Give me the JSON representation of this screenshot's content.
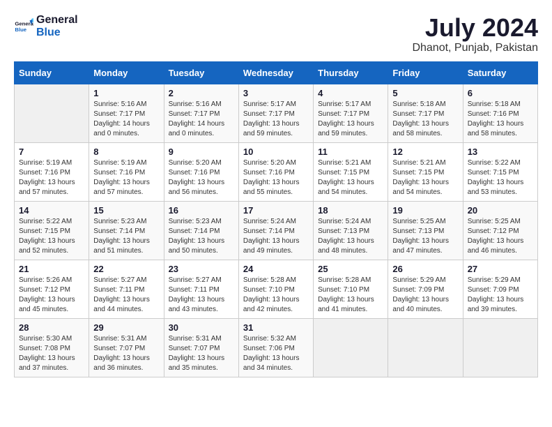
{
  "header": {
    "logo_general": "General",
    "logo_blue": "Blue",
    "month": "July 2024",
    "location": "Dhanot, Punjab, Pakistan"
  },
  "weekdays": [
    "Sunday",
    "Monday",
    "Tuesday",
    "Wednesday",
    "Thursday",
    "Friday",
    "Saturday"
  ],
  "weeks": [
    [
      {
        "day": "",
        "empty": true
      },
      {
        "day": "1",
        "sunrise": "5:16 AM",
        "sunset": "7:17 PM",
        "daylight": "14 hours and 0 minutes."
      },
      {
        "day": "2",
        "sunrise": "5:16 AM",
        "sunset": "7:17 PM",
        "daylight": "14 hours and 0 minutes."
      },
      {
        "day": "3",
        "sunrise": "5:17 AM",
        "sunset": "7:17 PM",
        "daylight": "13 hours and 59 minutes."
      },
      {
        "day": "4",
        "sunrise": "5:17 AM",
        "sunset": "7:17 PM",
        "daylight": "13 hours and 59 minutes."
      },
      {
        "day": "5",
        "sunrise": "5:18 AM",
        "sunset": "7:17 PM",
        "daylight": "13 hours and 58 minutes."
      },
      {
        "day": "6",
        "sunrise": "5:18 AM",
        "sunset": "7:16 PM",
        "daylight": "13 hours and 58 minutes."
      }
    ],
    [
      {
        "day": "7",
        "sunrise": "5:19 AM",
        "sunset": "7:16 PM",
        "daylight": "13 hours and 57 minutes."
      },
      {
        "day": "8",
        "sunrise": "5:19 AM",
        "sunset": "7:16 PM",
        "daylight": "13 hours and 57 minutes."
      },
      {
        "day": "9",
        "sunrise": "5:20 AM",
        "sunset": "7:16 PM",
        "daylight": "13 hours and 56 minutes."
      },
      {
        "day": "10",
        "sunrise": "5:20 AM",
        "sunset": "7:16 PM",
        "daylight": "13 hours and 55 minutes."
      },
      {
        "day": "11",
        "sunrise": "5:21 AM",
        "sunset": "7:15 PM",
        "daylight": "13 hours and 54 minutes."
      },
      {
        "day": "12",
        "sunrise": "5:21 AM",
        "sunset": "7:15 PM",
        "daylight": "13 hours and 54 minutes."
      },
      {
        "day": "13",
        "sunrise": "5:22 AM",
        "sunset": "7:15 PM",
        "daylight": "13 hours and 53 minutes."
      }
    ],
    [
      {
        "day": "14",
        "sunrise": "5:22 AM",
        "sunset": "7:15 PM",
        "daylight": "13 hours and 52 minutes."
      },
      {
        "day": "15",
        "sunrise": "5:23 AM",
        "sunset": "7:14 PM",
        "daylight": "13 hours and 51 minutes."
      },
      {
        "day": "16",
        "sunrise": "5:23 AM",
        "sunset": "7:14 PM",
        "daylight": "13 hours and 50 minutes."
      },
      {
        "day": "17",
        "sunrise": "5:24 AM",
        "sunset": "7:14 PM",
        "daylight": "13 hours and 49 minutes."
      },
      {
        "day": "18",
        "sunrise": "5:24 AM",
        "sunset": "7:13 PM",
        "daylight": "13 hours and 48 minutes."
      },
      {
        "day": "19",
        "sunrise": "5:25 AM",
        "sunset": "7:13 PM",
        "daylight": "13 hours and 47 minutes."
      },
      {
        "day": "20",
        "sunrise": "5:25 AM",
        "sunset": "7:12 PM",
        "daylight": "13 hours and 46 minutes."
      }
    ],
    [
      {
        "day": "21",
        "sunrise": "5:26 AM",
        "sunset": "7:12 PM",
        "daylight": "13 hours and 45 minutes."
      },
      {
        "day": "22",
        "sunrise": "5:27 AM",
        "sunset": "7:11 PM",
        "daylight": "13 hours and 44 minutes."
      },
      {
        "day": "23",
        "sunrise": "5:27 AM",
        "sunset": "7:11 PM",
        "daylight": "13 hours and 43 minutes."
      },
      {
        "day": "24",
        "sunrise": "5:28 AM",
        "sunset": "7:10 PM",
        "daylight": "13 hours and 42 minutes."
      },
      {
        "day": "25",
        "sunrise": "5:28 AM",
        "sunset": "7:10 PM",
        "daylight": "13 hours and 41 minutes."
      },
      {
        "day": "26",
        "sunrise": "5:29 AM",
        "sunset": "7:09 PM",
        "daylight": "13 hours and 40 minutes."
      },
      {
        "day": "27",
        "sunrise": "5:29 AM",
        "sunset": "7:09 PM",
        "daylight": "13 hours and 39 minutes."
      }
    ],
    [
      {
        "day": "28",
        "sunrise": "5:30 AM",
        "sunset": "7:08 PM",
        "daylight": "13 hours and 37 minutes."
      },
      {
        "day": "29",
        "sunrise": "5:31 AM",
        "sunset": "7:07 PM",
        "daylight": "13 hours and 36 minutes."
      },
      {
        "day": "30",
        "sunrise": "5:31 AM",
        "sunset": "7:07 PM",
        "daylight": "13 hours and 35 minutes."
      },
      {
        "day": "31",
        "sunrise": "5:32 AM",
        "sunset": "7:06 PM",
        "daylight": "13 hours and 34 minutes."
      },
      {
        "day": "",
        "empty": true
      },
      {
        "day": "",
        "empty": true
      },
      {
        "day": "",
        "empty": true
      }
    ]
  ]
}
